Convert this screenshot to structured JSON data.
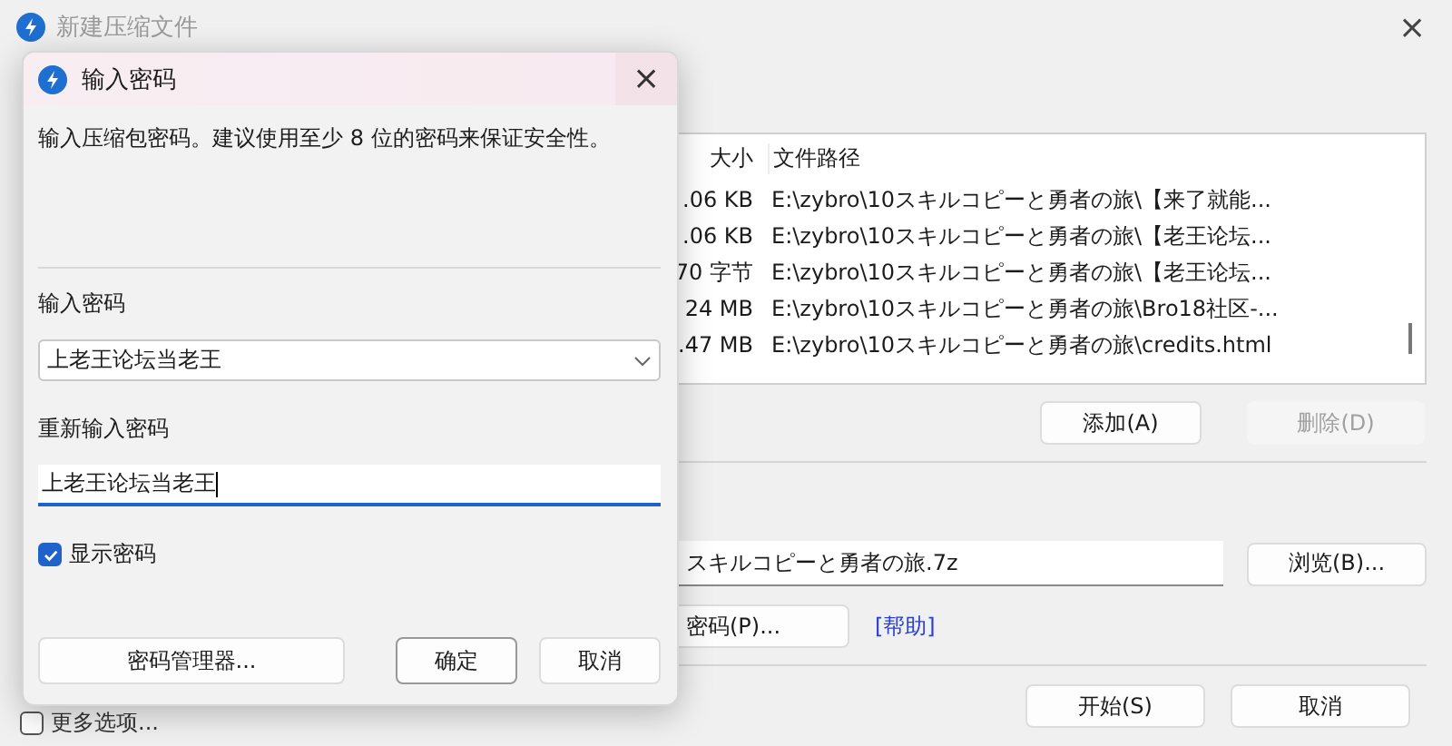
{
  "window": {
    "title": "新建压缩文件",
    "close": "×"
  },
  "file_table": {
    "columns": [
      "大小",
      "文件路径"
    ],
    "rows": [
      {
        "size": ".06 KB",
        "path": "E:\\zybro\\10スキルコピーと勇者の旅\\【来了就能..."
      },
      {
        "size": ".06 KB",
        "path": "E:\\zybro\\10スキルコピーと勇者の旅\\【老王论坛..."
      },
      {
        "size": "70 字节",
        "path": "E:\\zybro\\10スキルコピーと勇者の旅\\【老王论坛..."
      },
      {
        "size": "24 MB",
        "path": "E:\\zybro\\10スキルコピーと勇者の旅\\Bro18社区-..."
      },
      {
        "size": ".47 MB",
        "path": "E:\\zybro\\10スキルコピーと勇者の旅\\credits.html"
      }
    ]
  },
  "list_buttons": [
    {
      "label": "添加(A)",
      "disabled": false
    },
    {
      "label": "删除(D)",
      "disabled": true
    }
  ],
  "archive_path": {
    "value": "スキルコピーと勇者の旅.7z"
  },
  "browse_button": "浏览(B)...",
  "password_button": "密码(P)...",
  "help_link": "[帮助]",
  "more_options": {
    "label": "更多选项...",
    "checked": false
  },
  "footer_buttons": [
    "开始(S)",
    "取消"
  ],
  "dialog": {
    "title": "输入密码",
    "close": "×",
    "description": "输入压缩包密码。建议使用至少 8 位的密码来保证安全性。",
    "password_label": "输入密码",
    "password_value": "上老王论坛当老王",
    "confirm_label": "重新输入密码",
    "confirm_value": "上老王论坛当老王",
    "show_password": {
      "label": "显示密码",
      "checked": true
    },
    "manager_button": "密码管理器...",
    "ok_button": "确定",
    "cancel_button": "取消"
  }
}
